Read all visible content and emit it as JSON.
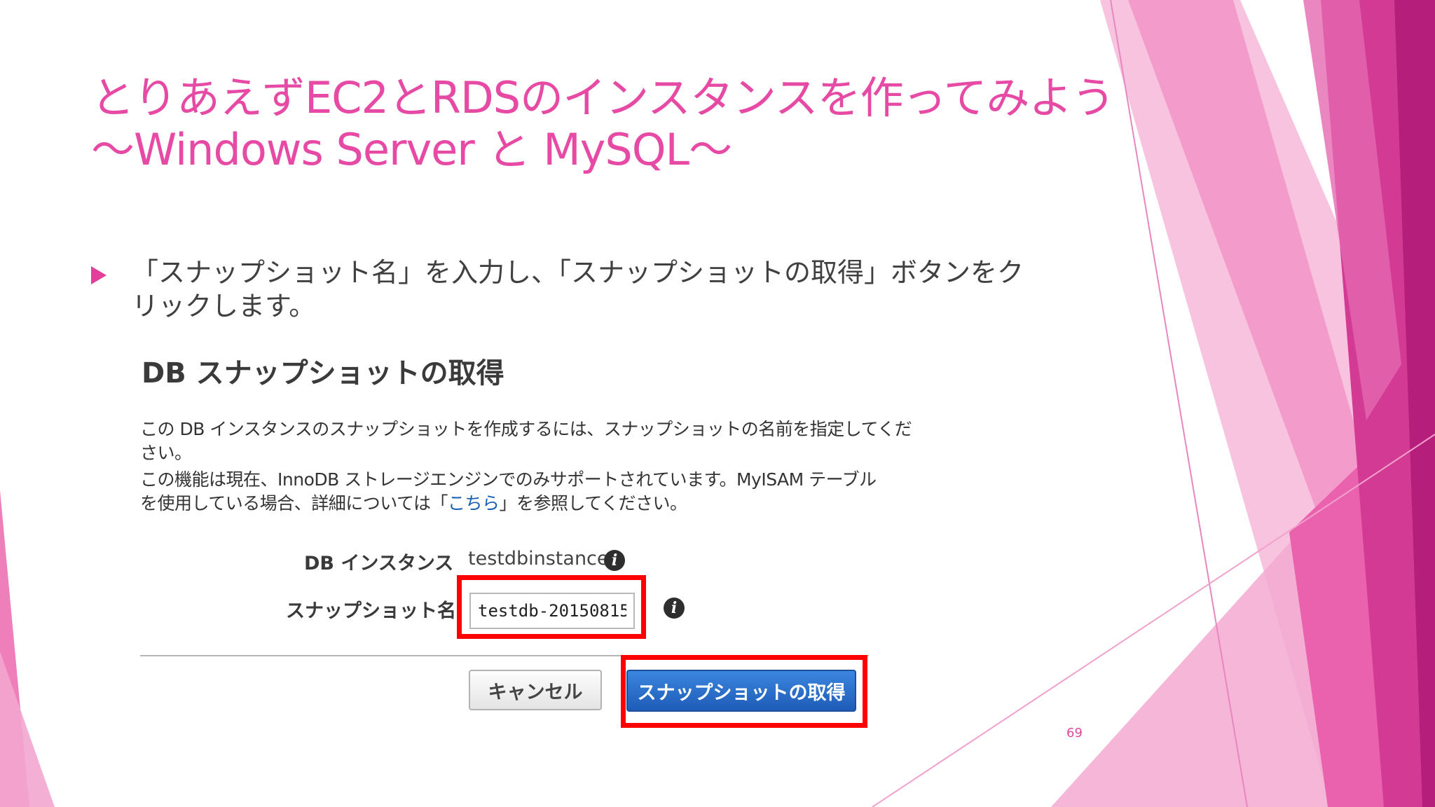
{
  "slide": {
    "title_line1": "とりあえずEC2とRDSのインスタンスを作ってみよう",
    "title_line2": "～Windows Server と MySQL～",
    "bullet_line1": "「スナップショット名」を入力し、「スナップショットの取得」ボタンをク",
    "bullet_line2": "リックします。",
    "slide_number": "69"
  },
  "dialog": {
    "title": "DB スナップショットの取得",
    "desc_line1": "この DB インスタンスのスナップショットを作成するには、スナップショットの名前を指定してくだ",
    "desc_line2": "さい。",
    "desc_line3": "この機能は現在、InnoDB ストレージエンジンでのみサポートされています。MyISAM テーブル",
    "desc_line4_a": "を使用している場合、詳細については「",
    "desc_link": "こちら",
    "desc_line4_b": "」を参照してください。",
    "db_instance_label": "DB インスタンス",
    "db_instance_value": "testdbinstance",
    "snapshot_name_label": "スナップショット名",
    "snapshot_name_value": "testdb-20150815",
    "cancel_label": "キャンセル",
    "take_snapshot_label": "スナップショットの取得"
  },
  "colors": {
    "accent": "#e23f9a",
    "title": "#e64aa5",
    "highlight": "#ff0000",
    "primary_button": "#1e5cb8"
  },
  "icons": {
    "bullet": "triangle-right-icon",
    "info": "info-icon"
  }
}
